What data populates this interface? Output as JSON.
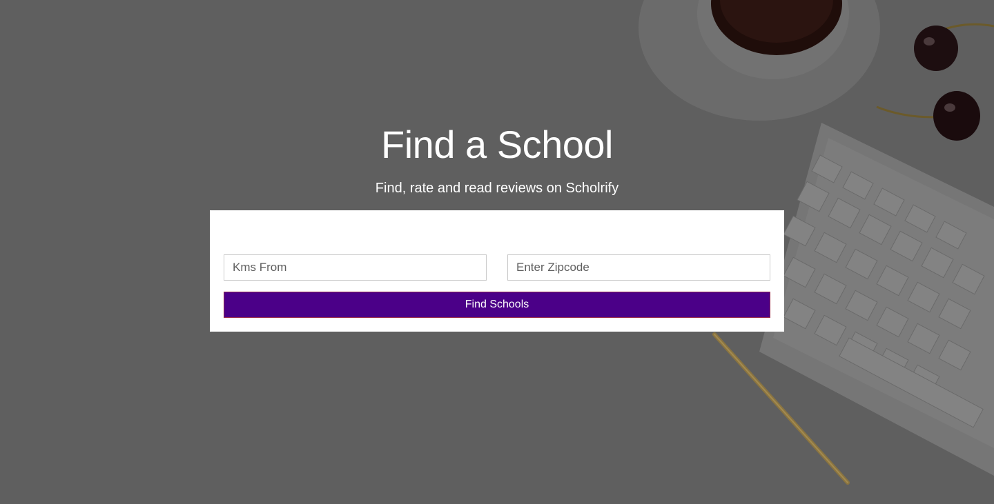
{
  "hero": {
    "title": "Find a School",
    "subtitle": "Find, rate and read reviews on Scholrify"
  },
  "search": {
    "kms_placeholder": "Kms From",
    "zipcode_placeholder": "Enter Zipcode",
    "submit_label": "Find Schools"
  },
  "colors": {
    "overlay": "#5f5f5f",
    "button_bg": "#4b0088",
    "card_bg": "#ffffff"
  },
  "background_icons": [
    "coffee-cup-icon",
    "cherry-icon",
    "keyboard-icon",
    "pen-icon"
  ]
}
